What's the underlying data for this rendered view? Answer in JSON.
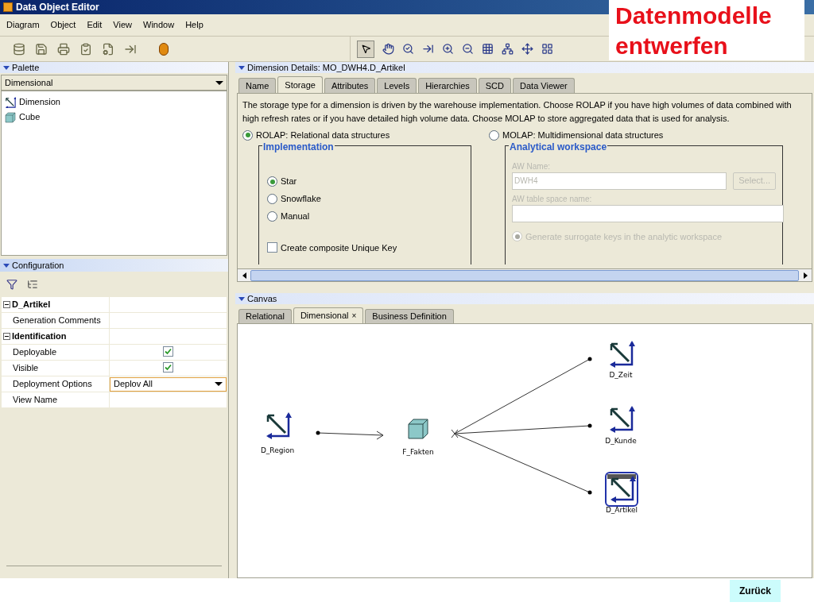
{
  "window": {
    "title": "Data Object Editor"
  },
  "menu": [
    "Diagram",
    "Object",
    "Edit",
    "View",
    "Window",
    "Help"
  ],
  "slide": {
    "title": "Datenmodelle entwerfen",
    "back_button": "Zurück"
  },
  "palette": {
    "title": "Palette",
    "dropdown": "Dimensional",
    "items": [
      {
        "label": "Dimension",
        "kind": "dimension"
      },
      {
        "label": "Cube",
        "kind": "cube"
      }
    ]
  },
  "configuration": {
    "title": "Configuration",
    "rows": [
      {
        "kind": "group",
        "label": "D_Artikel",
        "expanded": true
      },
      {
        "kind": "text",
        "label": "Generation Comments"
      },
      {
        "kind": "group",
        "label": "Identification",
        "expanded": true
      },
      {
        "kind": "checkbox",
        "label": "Deployable",
        "checked": true
      },
      {
        "kind": "checkbox",
        "label": "Visible",
        "checked": true
      },
      {
        "kind": "select",
        "label": "Deployment Options",
        "value": "Deplov All"
      },
      {
        "kind": "text",
        "label": "View Name"
      }
    ]
  },
  "details": {
    "title": "Dimension Details: MO_DWH4.D_Artikel",
    "tabs": [
      {
        "label": "Name",
        "selected": false
      },
      {
        "label": "Storage",
        "selected": true
      },
      {
        "label": "Attributes",
        "selected": false
      },
      {
        "label": "Levels",
        "selected": false
      },
      {
        "label": "Hierarchies",
        "selected": false
      },
      {
        "label": "SCD",
        "selected": false
      },
      {
        "label": "Data Viewer",
        "selected": false
      }
    ],
    "description": "The storage type for a dimension is driven by the warehouse implementation. Choose ROLAP if you have high volumes of data combined with high refresh rates or if you have detailed high volume data. Choose MOLAP to store aggregated data that is used for analysis.",
    "storage_options": [
      {
        "label": "ROLAP: Relational data structures",
        "selected": true
      },
      {
        "label": "MOLAP: Multidimensional data structures",
        "selected": false
      }
    ],
    "implementation": {
      "title": "Implementation",
      "options": [
        {
          "label": "Star",
          "selected": true
        },
        {
          "label": "Snowflake",
          "selected": false
        },
        {
          "label": "Manual",
          "selected": false
        }
      ],
      "composite_key": {
        "label": "Create composite Unique Key",
        "checked": false
      }
    },
    "analytical_workspace": {
      "title": "Analytical workspace",
      "disabled": true,
      "aw_name_label": "AW Name:",
      "aw_name_value": "DWH4",
      "select_button": "Select...",
      "tablespace_label": "AW table space name:",
      "surrogate": {
        "label": "Generate surrogate keys in the analytic workspace",
        "selected": true
      }
    }
  },
  "canvas": {
    "title": "Canvas",
    "tabs": [
      {
        "label": "Relational",
        "selected": false
      },
      {
        "label": "Dimensional",
        "selected": true,
        "close": "×"
      },
      {
        "label": "Business Definition",
        "selected": false
      }
    ],
    "nodes": [
      {
        "label": "D_Region",
        "kind": "dimension"
      },
      {
        "label": "F_Fakten",
        "kind": "cube"
      },
      {
        "label": "D_Zeit",
        "kind": "dimension"
      },
      {
        "label": "D_Kunde",
        "kind": "dimension"
      },
      {
        "label": "D_Artikel",
        "kind": "dimension_selected"
      }
    ]
  }
}
